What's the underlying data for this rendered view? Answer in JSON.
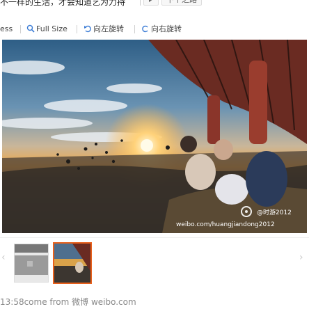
{
  "header": {
    "caption": "不一样的生活，才会知道艺为力持",
    "next_label": "下个之路"
  },
  "toolbar": {
    "partial_label": "ess",
    "full_size_label": "Full Size",
    "rotate_left_label": "向左旋转",
    "rotate_right_label": "向右旋转"
  },
  "photo": {
    "watermark_handle": "@时游2012",
    "watermark_url": "weibo.com/huangjiandong2012"
  },
  "footer": {
    "source_text": "13:58come from 微博 weibo.com"
  },
  "colors": {
    "thumb_selected_border": "#e8601c",
    "toolbar_icon": "#3a7bd5"
  }
}
